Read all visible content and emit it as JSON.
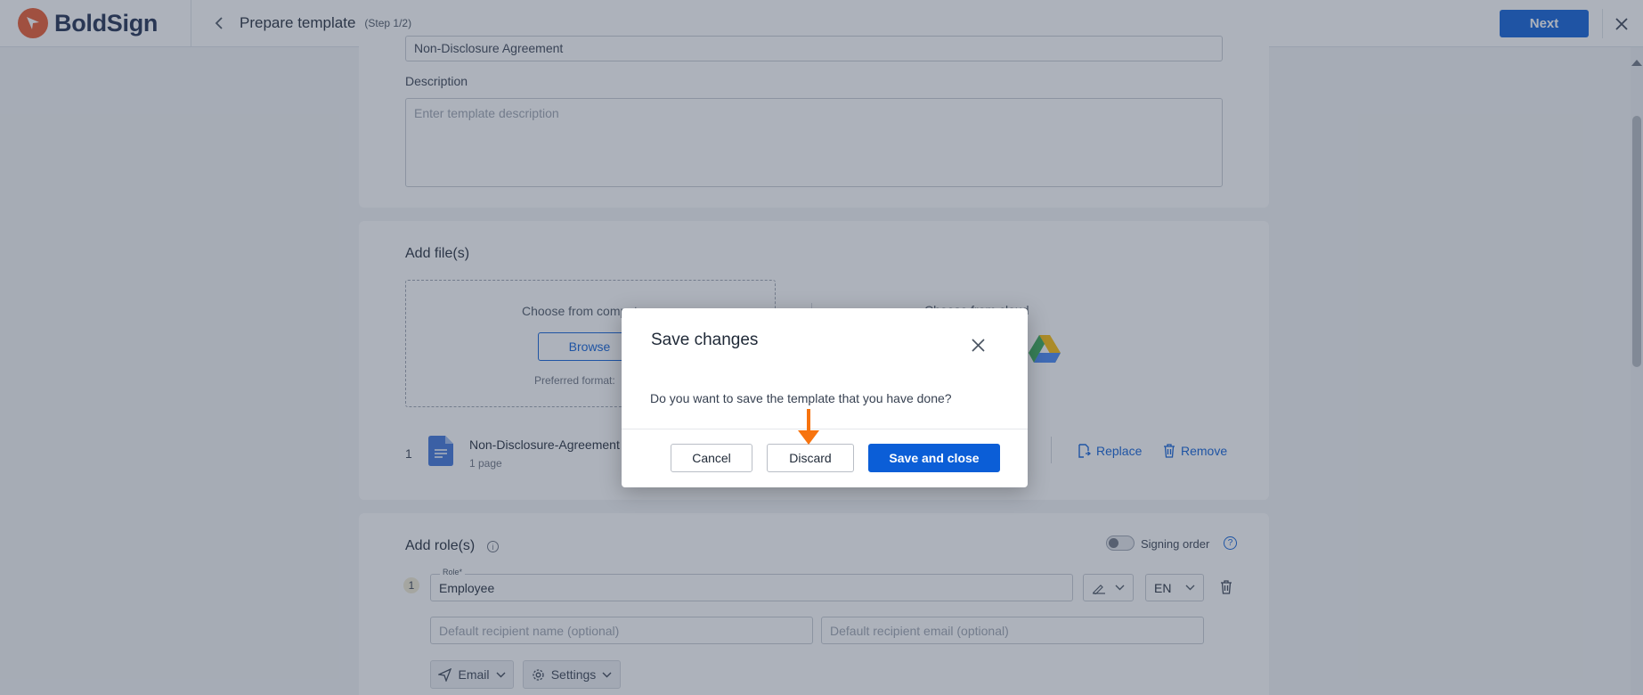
{
  "header": {
    "brand": "BoldSign",
    "title": "Prepare template",
    "step": "(Step 1/2)",
    "next_label": "Next"
  },
  "template": {
    "name_value": "Non-Disclosure Agreement",
    "description_label": "Description",
    "description_placeholder": "Enter template description"
  },
  "files": {
    "section_title": "Add file(s)",
    "choose_computer": "Choose from computer",
    "browse_label": "Browse",
    "preferred_format": "Preferred format:",
    "choose_cloud": "Choose from cloud",
    "file_index": "1",
    "file_name": "Non-Disclosure-Agreement",
    "file_pages": "1 page",
    "replace_label": "Replace",
    "remove_label": "Remove"
  },
  "roles": {
    "section_title": "Add role(s)",
    "signing_order_label": "Signing order",
    "help_label": "?",
    "role_index": "1",
    "role_label": "Role*",
    "role_value": "Employee",
    "language": "EN",
    "recipient_name_placeholder": "Default recipient name (optional)",
    "recipient_email_placeholder": "Default recipient email (optional)",
    "email_label": "Email",
    "settings_label": "Settings"
  },
  "modal": {
    "title": "Save changes",
    "message": "Do you want to save the template that you have done?",
    "cancel_label": "Cancel",
    "discard_label": "Discard",
    "save_label": "Save and close"
  },
  "colors": {
    "brand_orange": "#e8562c",
    "primary_blue": "#0b5ed7",
    "arrow_orange": "#f7730e"
  }
}
